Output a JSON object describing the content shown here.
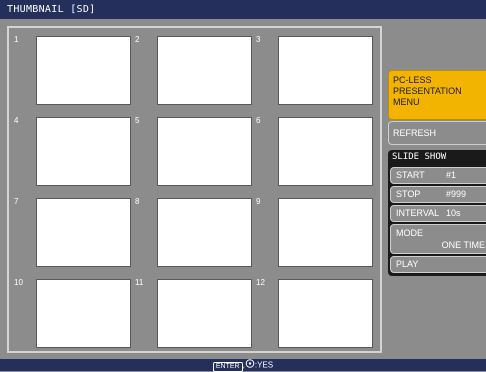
{
  "title_bar": {
    "text": "THUMBNAIL  [SD]"
  },
  "thumbnails": [
    {
      "index": "1"
    },
    {
      "index": "2"
    },
    {
      "index": "3"
    },
    {
      "index": "4"
    },
    {
      "index": "5"
    },
    {
      "index": "6"
    },
    {
      "index": "7"
    },
    {
      "index": "8"
    },
    {
      "index": "9"
    },
    {
      "index": "10"
    },
    {
      "index": "11"
    },
    {
      "index": "12"
    }
  ],
  "menu": {
    "pc_less_line1": "PC-LESS",
    "pc_less_line2": "PRESENTATION",
    "pc_less_line3": "MENU",
    "refresh": "REFRESH",
    "slide_show": {
      "title": "SLIDE SHOW",
      "start_label": "START",
      "start_value": "#1",
      "stop_label": "STOP",
      "stop_value": "#999",
      "interval_label": "INTERVAL",
      "interval_value": "10s",
      "mode_label": "MODE",
      "mode_value": "ONE TIME",
      "play_label": "PLAY"
    }
  },
  "status_bar": {
    "key": "ENTER",
    "text": ",",
    "icon": "joystick-icon",
    "action": ":YES"
  },
  "colors": {
    "background": "#8c8c8c",
    "bar": "#242f5c",
    "highlight": "#f2b400"
  }
}
